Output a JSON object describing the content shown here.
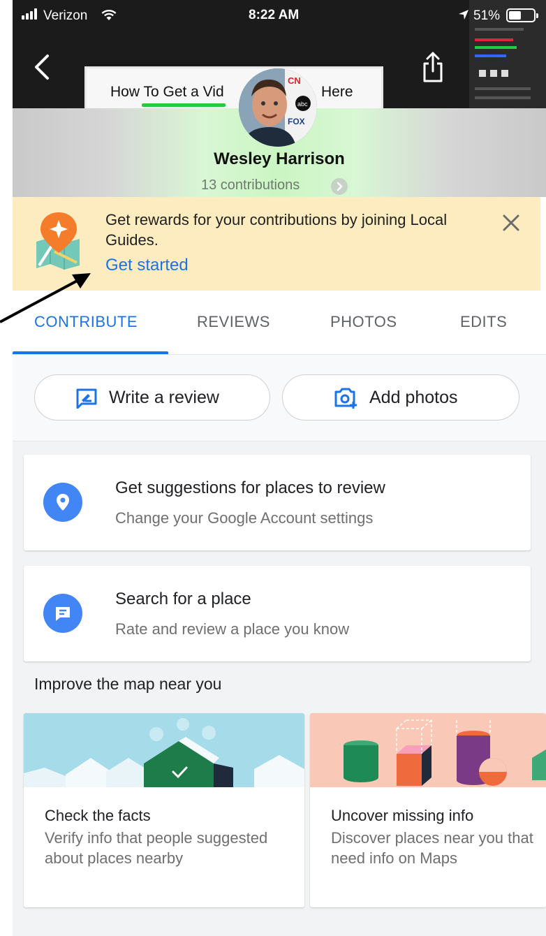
{
  "status_bar": {
    "carrier": "Verizon",
    "time": "8:22 AM",
    "battery_percent": "51%",
    "battery_level": 0.51
  },
  "header": {
    "video_title_left": "How To Get a Vid",
    "video_title_right": "Here"
  },
  "profile": {
    "name": "Wesley Harrison",
    "contributions": "13 contributions"
  },
  "promo": {
    "text": "Get rewards for your contributions by joining Local Guides.",
    "cta": "Get started"
  },
  "tabs": [
    {
      "label": "CONTRIBUTE",
      "active": true
    },
    {
      "label": "REVIEWS",
      "active": false
    },
    {
      "label": "PHOTOS",
      "active": false
    },
    {
      "label": "EDITS",
      "active": false
    }
  ],
  "actions": {
    "write_review": "Write a review",
    "add_photos": "Add photos"
  },
  "cards": [
    {
      "title": "Get suggestions for places to review",
      "subtitle": "Change your Google Account settings",
      "icon": "location-pin-icon"
    },
    {
      "title": "Search for a place",
      "subtitle": "Rate and review a place you know",
      "icon": "chat-icon"
    }
  ],
  "section_heading": "Improve the map near you",
  "tiles": [
    {
      "title": "Check the facts",
      "description": "Verify info that people suggested about places nearby"
    },
    {
      "title": "Uncover missing info",
      "description": "Discover places near you that need info on Maps"
    }
  ],
  "colors": {
    "accent": "#1a73e8",
    "promo_background": "#fcecc0",
    "icon_circle": "#4285f4"
  }
}
